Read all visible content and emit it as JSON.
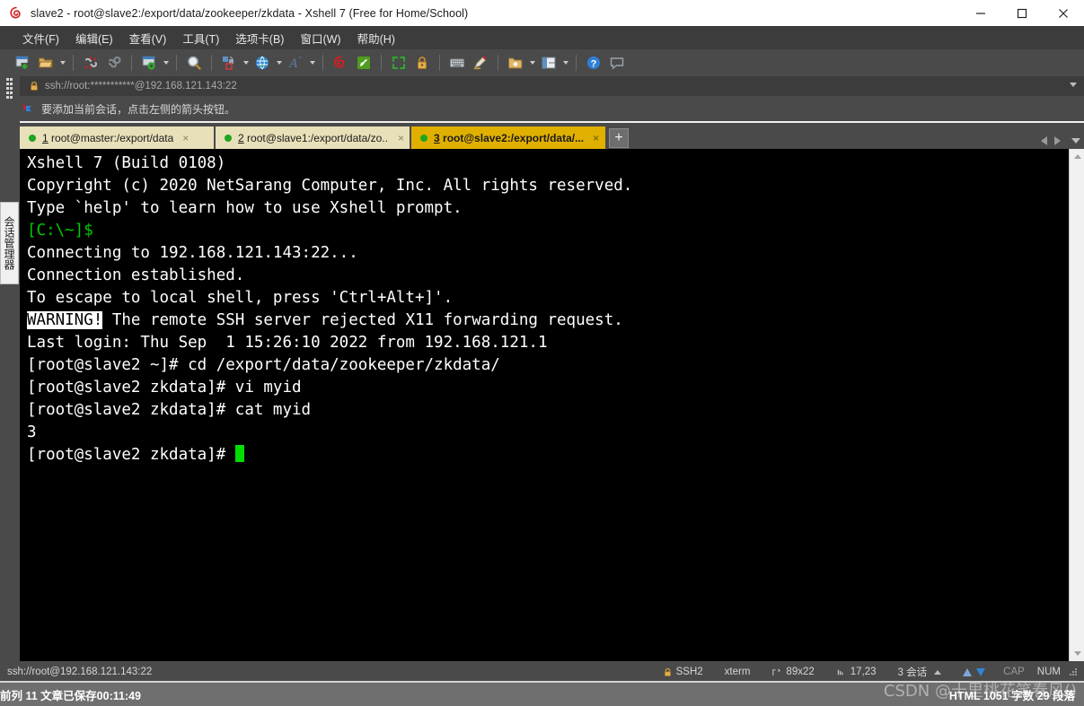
{
  "window": {
    "title": "slave2 - root@slave2:/export/data/zookeeper/zkdata - Xshell 7 (Free for Home/School)",
    "minimize_label": "minimize",
    "maximize_label": "maximize",
    "close_label": "close"
  },
  "menu": {
    "items": [
      {
        "label": "文件(F)"
      },
      {
        "label": "编辑(E)"
      },
      {
        "label": "查看(V)"
      },
      {
        "label": "工具(T)"
      },
      {
        "label": "选项卡(B)"
      },
      {
        "label": "窗口(W)"
      },
      {
        "label": "帮助(H)"
      }
    ]
  },
  "toolbar": {
    "buttons": [
      {
        "name": "new-session-icon"
      },
      {
        "name": "open-folder-icon"
      },
      {
        "name": "disconnect-icon"
      },
      {
        "name": "reconnect-icon"
      },
      {
        "name": "session-properties-icon"
      },
      {
        "name": "find-icon"
      },
      {
        "name": "layout-icon"
      },
      {
        "name": "globe-encoding-icon"
      },
      {
        "name": "font-icon"
      },
      {
        "name": "xshell-icon"
      },
      {
        "name": "xftp-icon"
      },
      {
        "name": "fullscreen-icon"
      },
      {
        "name": "lock-icon"
      },
      {
        "name": "keyboard-icon"
      },
      {
        "name": "highlight-pen-icon"
      },
      {
        "name": "new-folder-icon"
      },
      {
        "name": "split-view-icon"
      },
      {
        "name": "help-icon"
      },
      {
        "name": "chat-icon"
      }
    ]
  },
  "address": {
    "lock_icon": "lock-icon",
    "value": "ssh://root:***********@192.168.121.143:22",
    "dropdown_icon": "chevron-down-icon"
  },
  "hint": {
    "icon": "arrow-flag-icon",
    "text": "要添加当前会话，点击左侧的箭头按钮。"
  },
  "sidebar": {
    "rail_tab_label": "会话管理器"
  },
  "tabs": {
    "items": [
      {
        "number": "1",
        "label": "root@master:/export/data",
        "active": false,
        "status": "connected"
      },
      {
        "number": "2",
        "label": "root@slave1:/export/data/zo...",
        "active": false,
        "status": "connected"
      },
      {
        "number": "3",
        "label": "root@slave2:/export/data/...",
        "active": true,
        "status": "connected"
      }
    ],
    "add_label": "+",
    "close_label": "×",
    "nav_prev_icon": "chevron-left-icon",
    "nav_next_icon": "chevron-right-icon",
    "nav_list_icon": "chevron-down-icon"
  },
  "terminal": {
    "lines": [
      {
        "segments": [
          {
            "text": "Xshell 7 (Build 0108)",
            "style": "normal"
          }
        ]
      },
      {
        "segments": [
          {
            "text": "Copyright (c) 2020 NetSarang Computer, Inc. All rights reserved.",
            "style": "normal"
          }
        ]
      },
      {
        "segments": [
          {
            "text": "",
            "style": "normal"
          }
        ]
      },
      {
        "segments": [
          {
            "text": "Type `help' to learn how to use Xshell prompt.",
            "style": "normal"
          }
        ]
      },
      {
        "segments": [
          {
            "text": "[C:\\~]$",
            "style": "green"
          }
        ]
      },
      {
        "segments": [
          {
            "text": "",
            "style": "normal"
          }
        ]
      },
      {
        "segments": [
          {
            "text": "",
            "style": "normal"
          }
        ]
      },
      {
        "segments": [
          {
            "text": "Connecting to 192.168.121.143:22...",
            "style": "normal"
          }
        ]
      },
      {
        "segments": [
          {
            "text": "Connection established.",
            "style": "normal"
          }
        ]
      },
      {
        "segments": [
          {
            "text": "To escape to local shell, press 'Ctrl+Alt+]'.",
            "style": "normal"
          }
        ]
      },
      {
        "segments": [
          {
            "text": "",
            "style": "normal"
          }
        ]
      },
      {
        "segments": [
          {
            "text": "WARNING!",
            "style": "inverse"
          },
          {
            "text": " The remote SSH server rejected X11 forwarding request.",
            "style": "normal"
          }
        ]
      },
      {
        "segments": [
          {
            "text": "Last login: Thu Sep  1 15:26:10 2022 from 192.168.121.1",
            "style": "normal"
          }
        ]
      },
      {
        "segments": [
          {
            "text": "[root@slave2 ~]# cd /export/data/zookeeper/zkdata/",
            "style": "normal"
          }
        ]
      },
      {
        "segments": [
          {
            "text": "[root@slave2 zkdata]# vi myid",
            "style": "normal"
          }
        ]
      },
      {
        "segments": [
          {
            "text": "[root@slave2 zkdata]# cat myid",
            "style": "normal"
          }
        ]
      },
      {
        "segments": [
          {
            "text": "3",
            "style": "normal"
          }
        ]
      },
      {
        "segments": [
          {
            "text": "[root@slave2 zkdata]# ",
            "style": "normal"
          },
          {
            "text": "",
            "style": "cursor"
          }
        ]
      }
    ],
    "colors": {
      "background": "#000000",
      "foreground": "#ffffff",
      "green": "#00cc00",
      "cursor": "#00dd00"
    }
  },
  "statusbar": {
    "connection": "ssh://root@192.168.121.143:22",
    "protocol_icon": "lock-icon",
    "protocol": "SSH2",
    "terminal_type": "xterm",
    "size_icon": "resize-icon",
    "size": "89x22",
    "position_icon": "cursor-position-icon",
    "position": "17,23",
    "sessions": "3 会话",
    "sessions_caret_icon": "chevron-up-icon",
    "transfer_up_icon": "arrow-up-icon",
    "transfer_down_icon": "arrow-down-icon",
    "caps": "CAP",
    "num": "NUM",
    "resize_grip_icon": "resize-grip-icon"
  },
  "editor_status": {
    "left": "前列 11  文章已保存00:11:49",
    "right": "HTML  1051 字数  29 段落",
    "watermark": "CSDN @十里桃花笑春风()"
  }
}
